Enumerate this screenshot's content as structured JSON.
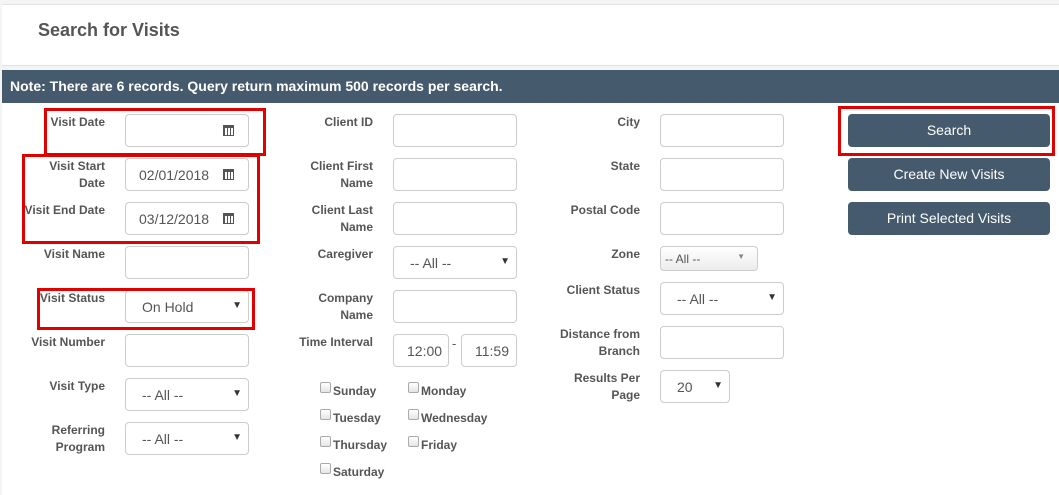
{
  "header": {
    "title": "Search for Visits"
  },
  "note": "Note: There are 6 records. Query return maximum 500 records per search.",
  "col1": {
    "visit_date": {
      "label": "Visit Date",
      "value": ""
    },
    "visit_start_date": {
      "label1": "Visit Start",
      "label2": "Date",
      "value": "02/01/2018"
    },
    "visit_end_date": {
      "label": "Visit End Date",
      "value": "03/12/2018"
    },
    "visit_name": {
      "label": "Visit Name",
      "value": ""
    },
    "visit_status": {
      "label": "Visit Status",
      "value": "On Hold"
    },
    "visit_number": {
      "label": "Visit Number",
      "value": ""
    },
    "visit_type": {
      "label": "Visit Type",
      "value": "-- All --"
    },
    "referring_program": {
      "label1": "Referring",
      "label2": "Program",
      "value": "-- All --"
    }
  },
  "col2": {
    "client_id": {
      "label": "Client ID",
      "value": ""
    },
    "client_first_name": {
      "label1": "Client First",
      "label2": "Name",
      "value": ""
    },
    "client_last_name": {
      "label1": "Client Last",
      "label2": "Name",
      "value": ""
    },
    "caregiver": {
      "label": "Caregiver",
      "value": "-- All --"
    },
    "company_name": {
      "label1": "Company",
      "label2": "Name",
      "value": ""
    },
    "time_interval": {
      "label": "Time Interval",
      "start": "12:00",
      "separator": "-",
      "end": "11:59"
    },
    "days": [
      "Sunday",
      "Monday",
      "Tuesday",
      "Wednesday",
      "Thursday",
      "Friday",
      "Saturday"
    ]
  },
  "col3": {
    "city": {
      "label": "City",
      "value": ""
    },
    "state": {
      "label": "State",
      "value": ""
    },
    "postal_code": {
      "label": "Postal Code",
      "value": ""
    },
    "zone": {
      "label": "Zone",
      "value": "-- All --"
    },
    "client_status": {
      "label": "Client Status",
      "value": "-- All --"
    },
    "distance": {
      "label1": "Distance from",
      "label2": "Branch",
      "value": ""
    },
    "results_per_page": {
      "label1": "Results Per",
      "label2": "Page",
      "value": "20"
    }
  },
  "actions": {
    "search": "Search",
    "create": "Create New Visits",
    "print": "Print Selected Visits"
  },
  "icons": {
    "calendar": "calendar-icon",
    "dropdown": "caret-down-icon"
  },
  "colors": {
    "accent": "#455a6d",
    "highlight": "#e00000"
  }
}
